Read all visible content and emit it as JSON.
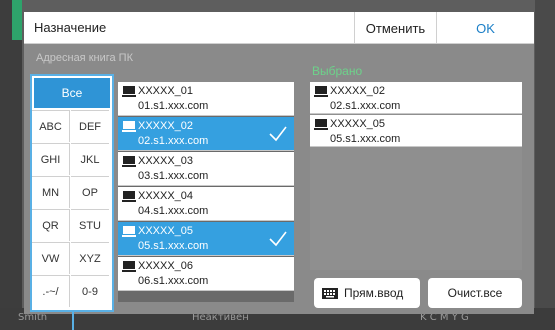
{
  "dialog": {
    "title": "Назначение",
    "cancel_label": "Отменить",
    "ok_label": "OK"
  },
  "address_book": {
    "label": "Адресная книга ПК",
    "items": [
      {
        "name": "XXXXX_01",
        "host": "01.s1.xxx.com",
        "selected": false
      },
      {
        "name": "XXXXX_02",
        "host": "02.s1.xxx.com",
        "selected": true
      },
      {
        "name": "XXXXX_03",
        "host": "03.s1.xxx.com",
        "selected": false
      },
      {
        "name": "XXXXX_04",
        "host": "04.s1.xxx.com",
        "selected": false
      },
      {
        "name": "XXXXX_05",
        "host": "05.s1.xxx.com",
        "selected": true
      },
      {
        "name": "XXXXX_06",
        "host": "06.s1.xxx.com",
        "selected": false
      }
    ]
  },
  "alpha_index": {
    "all": "Все",
    "cells": [
      "ABC",
      "DEF",
      "GHI",
      "JKL",
      "MN",
      "OP",
      "QR",
      "STU",
      "VW",
      "XYZ",
      ".-~/",
      "0-9"
    ]
  },
  "selected_panel": {
    "label": "Выбрано",
    "items": [
      {
        "name": "XXXXX_02",
        "host": "02.s1.xxx.com"
      },
      {
        "name": "XXXXX_05",
        "host": "05.s1.xxx.com"
      }
    ]
  },
  "actions": {
    "direct_entry": "Прям.ввод",
    "clear_all": "Очист.все"
  },
  "background": {
    "bottom_left": "Smith",
    "bottom_center": "Неактивен",
    "bottom_right": "K  C  M  Y  G"
  },
  "colors": {
    "accent_blue": "#2f94d6",
    "selected_label_green": "#6dd28a",
    "ok_blue": "#1b7fc7"
  }
}
